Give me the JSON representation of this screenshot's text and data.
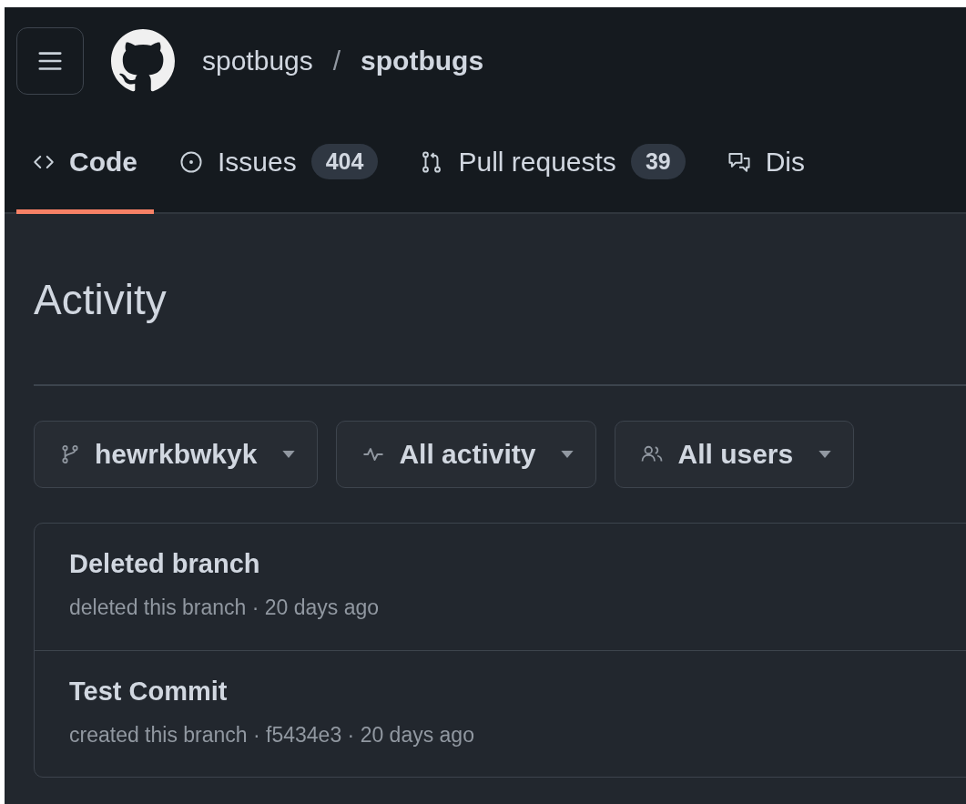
{
  "header": {
    "owner": "spotbugs",
    "separator": "/",
    "repo": "spotbugs"
  },
  "tabs": [
    {
      "kind": "code",
      "label": "Code",
      "selected": true
    },
    {
      "kind": "issues",
      "label": "Issues",
      "count": "404",
      "selected": false
    },
    {
      "kind": "pulls",
      "label": "Pull requests",
      "count": "39",
      "selected": false
    },
    {
      "kind": "discussions",
      "label": "Dis",
      "selected": false
    }
  ],
  "page_title": "Activity",
  "filters": [
    {
      "kind": "branch",
      "label": "hewrkbwkyk"
    },
    {
      "kind": "activity",
      "label": "All activity"
    },
    {
      "kind": "users",
      "label": "All users"
    }
  ],
  "activity": [
    {
      "title": "Deleted branch",
      "meta": "deleted this branch · 20 days ago"
    },
    {
      "title": "Test Commit",
      "meta": "created this branch · f5434e3 · 20 days ago"
    }
  ]
}
